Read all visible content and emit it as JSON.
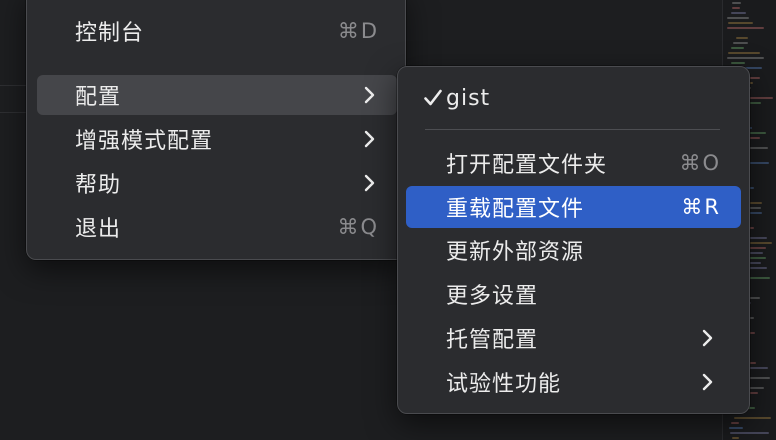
{
  "main_menu": {
    "items": [
      {
        "label": "控制台",
        "shortcut": "⌘D"
      },
      {
        "label": "配置"
      },
      {
        "label": "增强模式配置"
      },
      {
        "label": "帮助"
      },
      {
        "label": "退出",
        "shortcut": "⌘Q"
      }
    ]
  },
  "sub_menu": {
    "profile": "gist",
    "items": [
      {
        "label": "打开配置文件夹",
        "shortcut": "⌘O"
      },
      {
        "label": "重载配置文件",
        "shortcut": "⌘R"
      },
      {
        "label": "更新外部资源"
      },
      {
        "label": "更多设置"
      },
      {
        "label": "托管配置"
      },
      {
        "label": "试验性功能"
      }
    ]
  },
  "colors": {
    "selection": "#2f5fc6",
    "menu_bg": "#2b2c2f",
    "hover": "#45464a"
  }
}
